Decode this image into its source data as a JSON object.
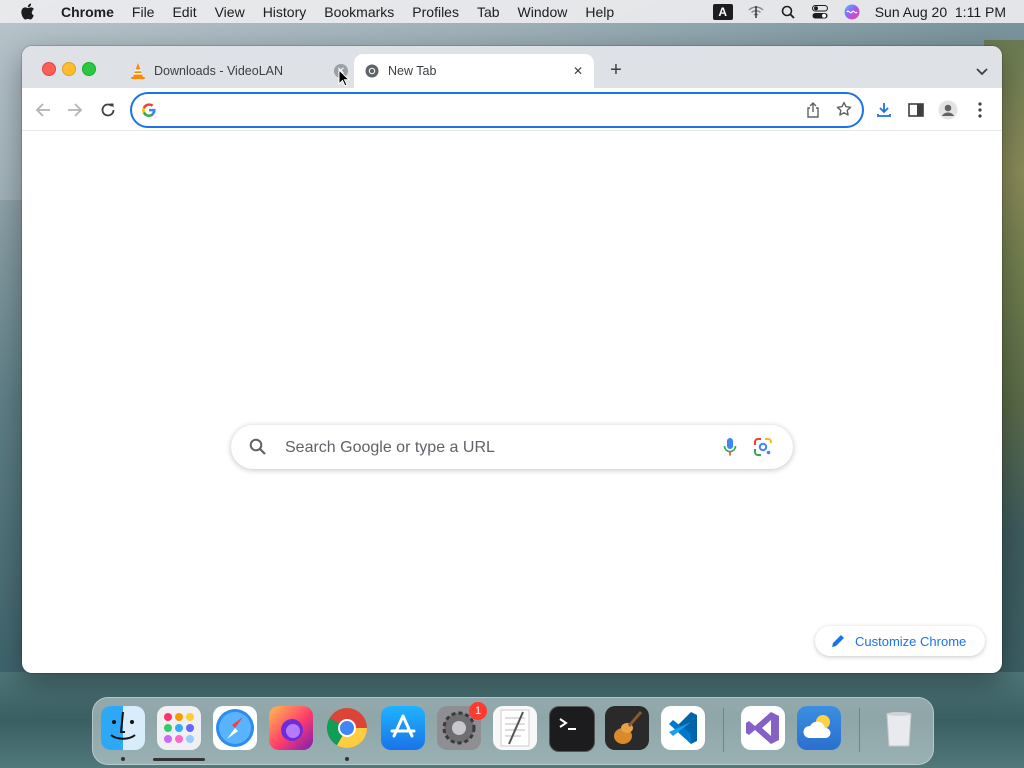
{
  "menubar": {
    "app_name": "Chrome",
    "items": [
      "File",
      "Edit",
      "View",
      "History",
      "Bookmarks",
      "Profiles",
      "Tab",
      "Window",
      "Help"
    ],
    "input_source": "A",
    "datetime": "Sun Aug 20  1:11 PM"
  },
  "browser": {
    "tabs": [
      {
        "title": "Downloads - VideoLAN",
        "favicon": "vlc-cone-icon",
        "active": false
      },
      {
        "title": "New Tab",
        "favicon": "chrome-icon",
        "active": true
      }
    ],
    "omnibox": {
      "value": "",
      "placeholder": ""
    },
    "accent_color": "#1a73e8"
  },
  "ntp": {
    "search_placeholder": "Search Google or type a URL",
    "customize_label": "Customize Chrome"
  },
  "dock": {
    "apps": [
      {
        "name": "Finder",
        "running": true
      },
      {
        "name": "Launchpad",
        "running": false
      },
      {
        "name": "Safari",
        "running": false
      },
      {
        "name": "Firefox",
        "running": false
      },
      {
        "name": "Google Chrome",
        "running": true
      },
      {
        "name": "App Store",
        "running": false
      },
      {
        "name": "System Settings",
        "running": false,
        "badge": "1"
      },
      {
        "name": "TextEdit",
        "running": false
      },
      {
        "name": "Terminal",
        "running": false
      },
      {
        "name": "GarageBand",
        "running": false
      },
      {
        "name": "Visual Studio Code",
        "running": false
      },
      {
        "name": "Visual Studio",
        "running": false
      },
      {
        "name": "Weather",
        "running": false
      },
      {
        "name": "Trash",
        "running": false
      }
    ]
  }
}
